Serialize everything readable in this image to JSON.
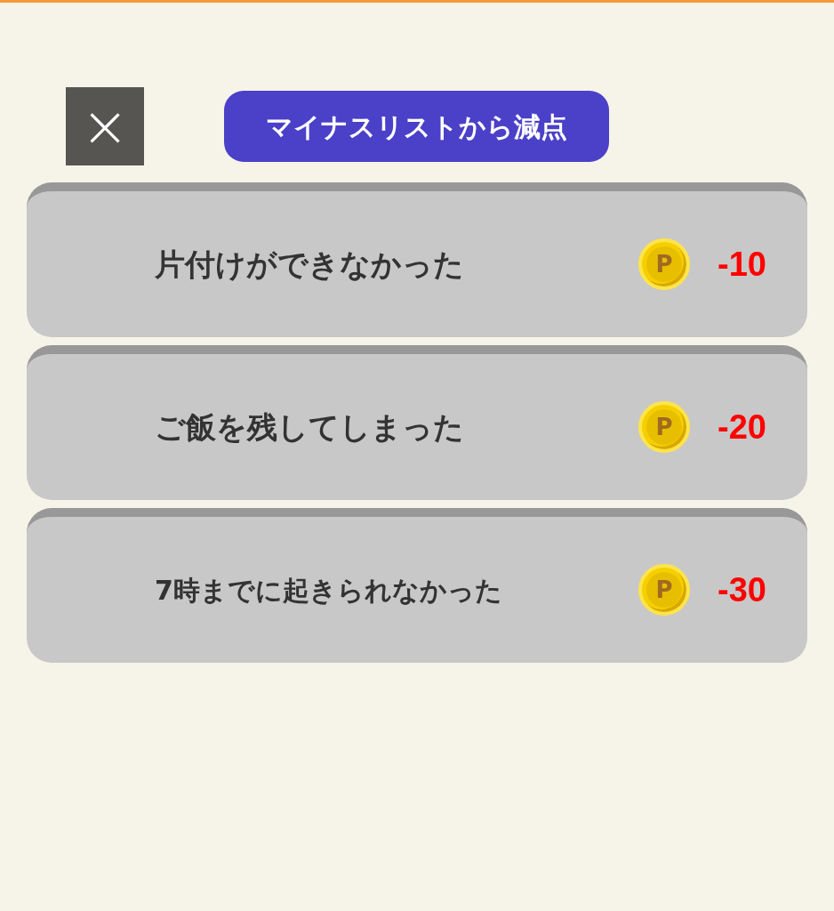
{
  "close_button": {
    "label": "×"
  },
  "title": "マイナスリストから減点",
  "items": [
    {
      "label": "片付けができなかった",
      "coin": "P",
      "points": "-10"
    },
    {
      "label": "ご飯を残してしまった",
      "coin": "P",
      "points": "-20"
    },
    {
      "label": "7時までに起きられなかった",
      "coin": "P",
      "points": "-30"
    }
  ]
}
